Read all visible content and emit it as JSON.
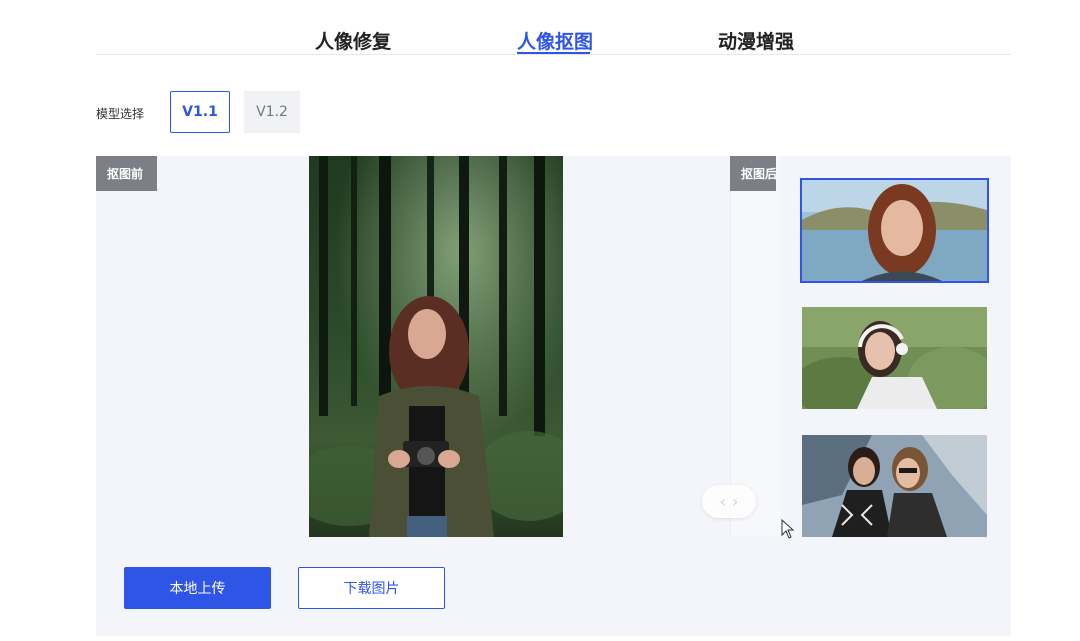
{
  "tabs": [
    {
      "label": "人像修复"
    },
    {
      "label": "人像抠图"
    },
    {
      "label": "动漫增强"
    }
  ],
  "active_tab": "人像抠图",
  "model": {
    "label": "模型选择",
    "versions": [
      "V1.1",
      "V1.2"
    ],
    "selected": "V1.1"
  },
  "compare": {
    "before_label": "抠图前",
    "after_label": "抠图后",
    "handle_icons": [
      "chevron-left-icon",
      "chevron-right-icon"
    ]
  },
  "samples": [
    {
      "name": "red-haired-woman-lake",
      "selected": true
    },
    {
      "name": "woman-headphones-grass",
      "selected": false
    },
    {
      "name": "couple-rocks",
      "selected": false
    }
  ],
  "actions": {
    "upload": "本地上传",
    "download": "下载图片"
  },
  "colors": {
    "accent": "#2f55e6",
    "panel": "#f3f5fa",
    "badge": "#7c7f86"
  }
}
